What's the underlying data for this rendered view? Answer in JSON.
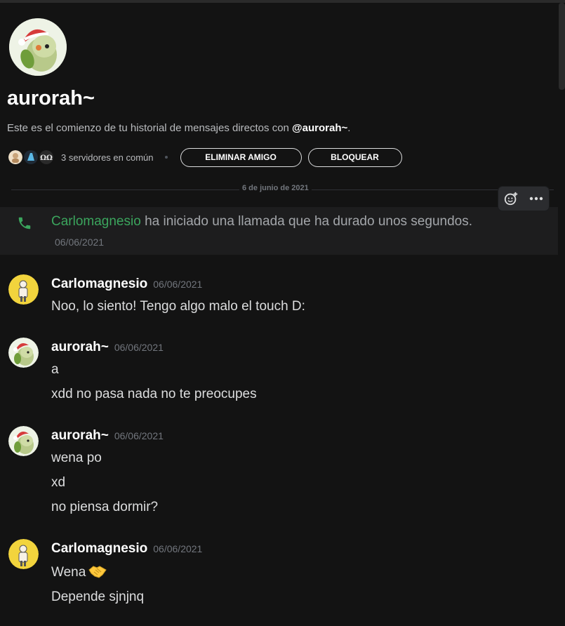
{
  "profile": {
    "name": "aurorah~",
    "intro_prefix": "Este es el comienzo de tu historial de mensajes directos con ",
    "intro_handle": "@aurorah~",
    "intro_suffix": ".",
    "mutual_servers": "3 servidores en común",
    "remove_friend_label": "ELIMINAR AMIGO",
    "block_label": "BLOQUEAR"
  },
  "date_divider": "6 de junio de 2021",
  "call": {
    "caller": "Carlomagnesio",
    "text": " ha iniciado una llamada que ha durado unos segundos.",
    "date": "06/06/2021"
  },
  "messages": [
    {
      "author": "Carlomagnesio",
      "time": "06/06/2021",
      "lines": [
        "Noo, lo siento! Tengo algo malo el touch D:"
      ]
    },
    {
      "author": "aurorah~",
      "time": "06/06/2021",
      "lines": [
        "a",
        "xdd no pasa nada no te preocupes"
      ]
    },
    {
      "author": "aurorah~",
      "time": "06/06/2021",
      "lines": [
        "wena po",
        "xd",
        "no piensa dormir?"
      ]
    },
    {
      "author": "Carlomagnesio",
      "time": "06/06/2021",
      "lines": [
        "Wena",
        "Depende sjnjnq"
      ]
    }
  ],
  "icons": {
    "call": "phone-icon",
    "add_reaction": "add-reaction-icon",
    "more": "more-options-icon",
    "handshake": "handshake-emoji"
  },
  "colors": {
    "background": "#131313",
    "call_name": "#3ba55d",
    "timestamp": "#72767d"
  }
}
